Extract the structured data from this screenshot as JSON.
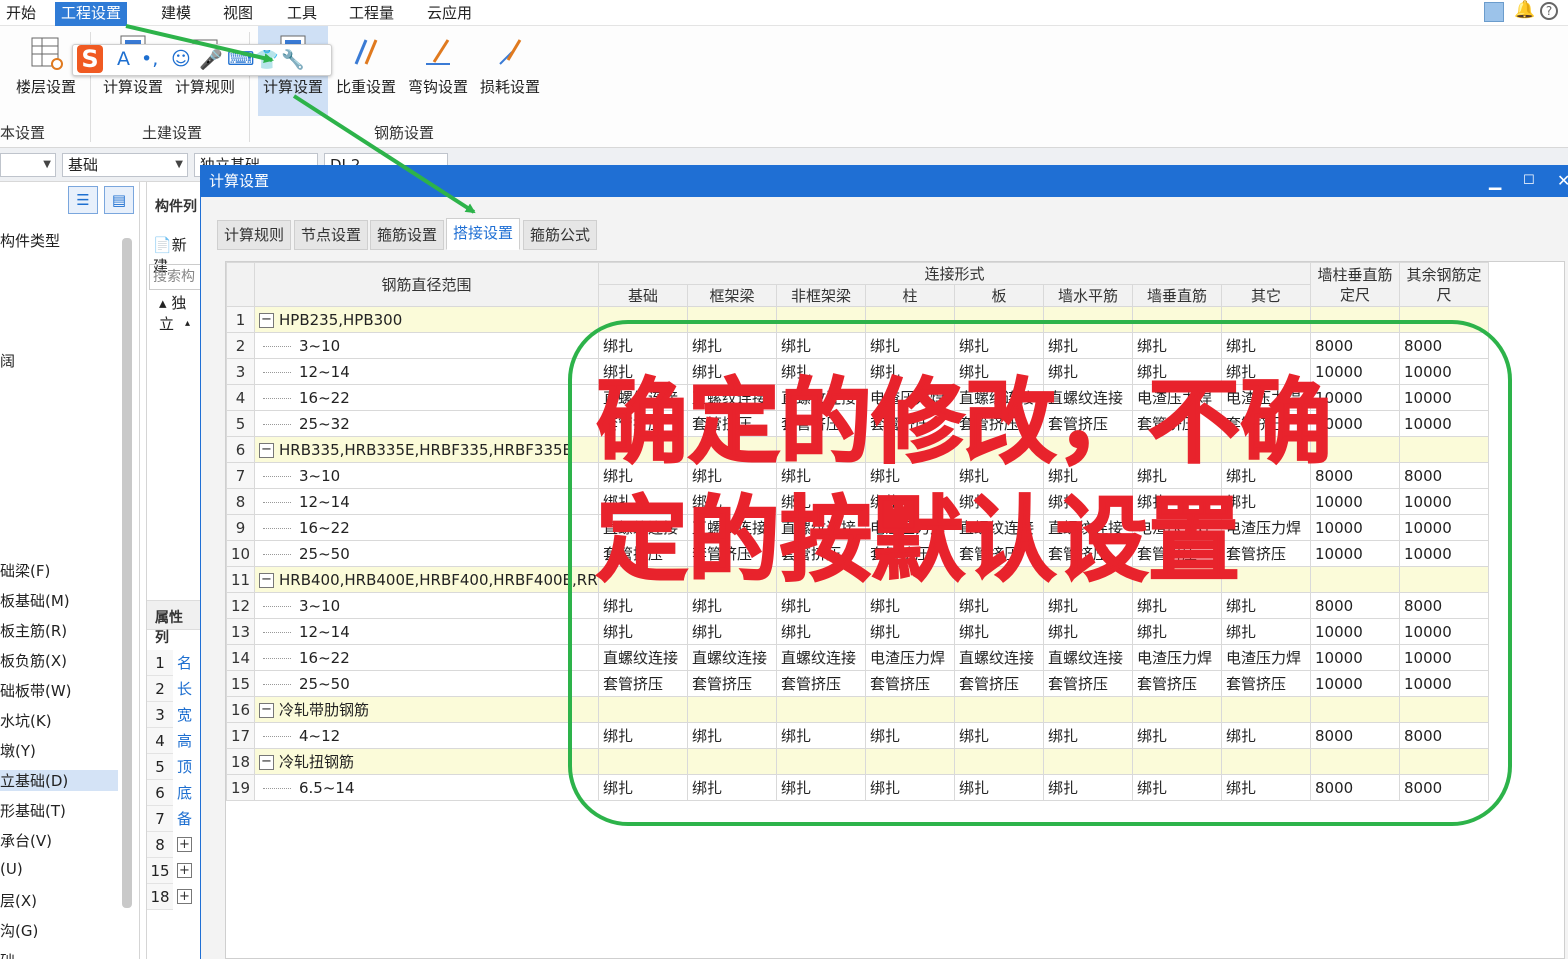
{
  "menu": [
    "开始",
    "工程设置",
    "建模",
    "视图",
    "工具",
    "工程量",
    "云应用"
  ],
  "ribbon": {
    "buttons": [
      "楼层设置",
      "计算设置",
      "计算规则",
      "计算设置",
      "比重设置",
      "弯钩设置",
      "损耗设置"
    ],
    "groups": [
      "本设置",
      "土建设置",
      "钢筋设置"
    ]
  },
  "combos": [
    "",
    "基础",
    "独立基础",
    "DJ-2"
  ],
  "left_panel": {
    "header": "构件类型",
    "items": [
      "础梁(F)",
      "板基础(M)",
      "板主筋(R)",
      "板负筋(X)",
      "础板带(W)",
      "水坑(K)",
      "墩(Y)",
      "立基础(D)",
      "形基础(T)",
      "承台(V)",
      "(U)",
      "层(X)",
      "沟(G)",
      "础"
    ],
    "stub": "阔"
  },
  "mid_panel": {
    "title": "构件列",
    "new": "新建",
    "search": "搜索构",
    "tree": "独立",
    "attr": "属性列",
    "rows": [
      {
        "n": "1",
        "t": "名"
      },
      {
        "n": "2",
        "t": "长"
      },
      {
        "n": "3",
        "t": "宽"
      },
      {
        "n": "4",
        "t": "高"
      },
      {
        "n": "5",
        "t": "顶"
      },
      {
        "n": "6",
        "t": "底"
      },
      {
        "n": "7",
        "t": "备"
      },
      {
        "n": "8",
        "t": "+"
      },
      {
        "n": "15",
        "t": "+"
      },
      {
        "n": "18",
        "t": "+"
      }
    ]
  },
  "dialog": {
    "title": "计算设置",
    "tabs": [
      "计算规则",
      "节点设置",
      "箍筋设置",
      "搭接设置",
      "箍筋公式"
    ],
    "active_tab": "搭接设置",
    "headers": {
      "range": "钢筋直径范围",
      "conn": "连接形式",
      "cols": [
        "基础",
        "框架梁",
        "非框架梁",
        "柱",
        "板",
        "墙水平筋",
        "墙垂直筋",
        "其它"
      ],
      "wall_len": "墙柱垂直筋定尺",
      "other_len": "其余钢筋定尺"
    },
    "rows": [
      {
        "n": "1",
        "group": true,
        "label": "HPB235,HPB300"
      },
      {
        "n": "2",
        "label": "3~10",
        "cells": [
          "绑扎",
          "绑扎",
          "绑扎",
          "绑扎",
          "绑扎",
          "绑扎",
          "绑扎",
          "绑扎",
          "8000",
          "8000"
        ]
      },
      {
        "n": "3",
        "label": "12~14",
        "cells": [
          "绑扎",
          "绑扎",
          "绑扎",
          "绑扎",
          "绑扎",
          "绑扎",
          "绑扎",
          "绑扎",
          "10000",
          "10000"
        ]
      },
      {
        "n": "4",
        "label": "16~22",
        "cells": [
          "直螺纹连接",
          "直螺纹连接",
          "直螺纹连接",
          "电渣压力焊",
          "直螺纹连接",
          "直螺纹连接",
          "电渣压力焊",
          "电渣压力焊",
          "10000",
          "10000"
        ]
      },
      {
        "n": "5",
        "label": "25~32",
        "cells": [
          "套管挤压",
          "套管挤压",
          "套管挤压",
          "套管挤压",
          "套管挤压",
          "套管挤压",
          "套管挤压",
          "套管挤压",
          "10000",
          "10000"
        ]
      },
      {
        "n": "6",
        "group": true,
        "label": "HRB335,HRB335E,HRBF335,HRBF335E"
      },
      {
        "n": "7",
        "label": "3~10",
        "cells": [
          "绑扎",
          "绑扎",
          "绑扎",
          "绑扎",
          "绑扎",
          "绑扎",
          "绑扎",
          "绑扎",
          "8000",
          "8000"
        ]
      },
      {
        "n": "8",
        "label": "12~14",
        "cells": [
          "绑扎",
          "绑扎",
          "绑扎",
          "绑扎",
          "绑扎",
          "绑扎",
          "绑扎",
          "绑扎",
          "10000",
          "10000"
        ]
      },
      {
        "n": "9",
        "label": "16~22",
        "cells": [
          "直螺纹连接",
          "直螺纹连接",
          "直螺纹连接",
          "电渣压力焊",
          "直螺纹连接",
          "直螺纹连接",
          "电渣压力焊",
          "电渣压力焊",
          "10000",
          "10000"
        ]
      },
      {
        "n": "10",
        "label": "25~50",
        "cells": [
          "套管挤压",
          "套管挤压",
          "套管挤压",
          "套管挤压",
          "套管挤压",
          "套管挤压",
          "套管挤压",
          "套管挤压",
          "10000",
          "10000"
        ]
      },
      {
        "n": "11",
        "group": true,
        "label": "HRB400,HRB400E,HRBF400,HRBF400E,RR..."
      },
      {
        "n": "12",
        "label": "3~10",
        "cells": [
          "绑扎",
          "绑扎",
          "绑扎",
          "绑扎",
          "绑扎",
          "绑扎",
          "绑扎",
          "绑扎",
          "8000",
          "8000"
        ]
      },
      {
        "n": "13",
        "label": "12~14",
        "cells": [
          "绑扎",
          "绑扎",
          "绑扎",
          "绑扎",
          "绑扎",
          "绑扎",
          "绑扎",
          "绑扎",
          "10000",
          "10000"
        ]
      },
      {
        "n": "14",
        "label": "16~22",
        "cells": [
          "直螺纹连接",
          "直螺纹连接",
          "直螺纹连接",
          "电渣压力焊",
          "直螺纹连接",
          "直螺纹连接",
          "电渣压力焊",
          "电渣压力焊",
          "10000",
          "10000"
        ]
      },
      {
        "n": "15",
        "label": "25~50",
        "cells": [
          "套管挤压",
          "套管挤压",
          "套管挤压",
          "套管挤压",
          "套管挤压",
          "套管挤压",
          "套管挤压",
          "套管挤压",
          "10000",
          "10000"
        ]
      },
      {
        "n": "16",
        "group": true,
        "label": "冷轧带肋钢筋"
      },
      {
        "n": "17",
        "label": "4~12",
        "cells": [
          "绑扎",
          "绑扎",
          "绑扎",
          "绑扎",
          "绑扎",
          "绑扎",
          "绑扎",
          "绑扎",
          "8000",
          "8000"
        ]
      },
      {
        "n": "18",
        "group": true,
        "label": "冷轧扭钢筋"
      },
      {
        "n": "19",
        "label": "6.5~14",
        "cells": [
          "绑扎",
          "绑扎",
          "绑扎",
          "绑扎",
          "绑扎",
          "绑扎",
          "绑扎",
          "绑扎",
          "8000",
          "8000"
        ]
      }
    ]
  },
  "overlay": {
    "line1": "确定的修改，不确",
    "line2": "定的按默认设置",
    "color": "#e8232c",
    "border_color": "#2db34a"
  },
  "arrow_color": "#2db34a"
}
